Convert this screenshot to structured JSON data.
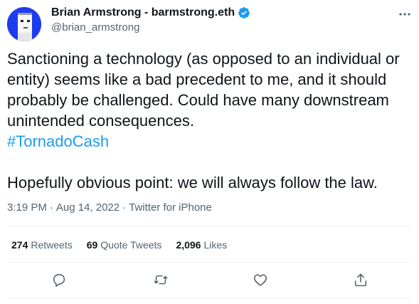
{
  "author": {
    "display_name": "Brian Armstrong - barmstrong.eth",
    "handle": "@brian_armstrong",
    "verified_icon": "verified-badge-icon",
    "avatar_icon": "pixel-punk-avatar",
    "accent_color": "#1d9bf0"
  },
  "tweet": {
    "line1": "Sanctioning a technology (as opposed to an individual or entity) seems like a bad precedent to me, and it should probably be challenged. Could have many downstream unintended consequences.",
    "hashtag": "#TornadoCash",
    "line2": "Hopefully obvious point: we will always follow the law."
  },
  "meta": {
    "time": "3:19 PM",
    "date": "Aug 14, 2022",
    "source": "Twitter for iPhone",
    "separator": "·"
  },
  "stats": {
    "retweets_count": "274",
    "retweets_label": "Retweets",
    "quotes_count": "69",
    "quotes_label": "Quote Tweets",
    "likes_count": "2,096",
    "likes_label": "Likes"
  },
  "actions": [
    "reply-icon",
    "retweet-icon",
    "like-icon",
    "share-icon"
  ],
  "more_icon": "more-options-icon"
}
